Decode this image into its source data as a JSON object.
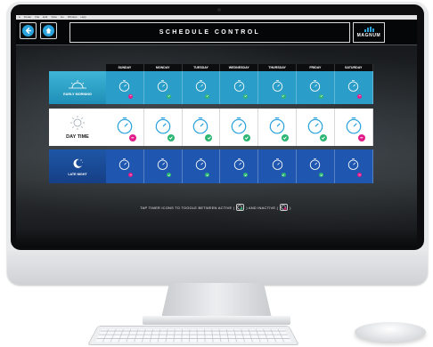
{
  "menubar": {
    "items": [
      "",
      "Finder",
      "File",
      "Edit",
      "View",
      "Go",
      "Window",
      "Help"
    ]
  },
  "header": {
    "title": "SCHEDULE CONTROL",
    "logo_text": "MAGNUM",
    "back_icon": "arrow-left-icon",
    "home_icon": "home-icon"
  },
  "days": [
    "SUNDAY",
    "MONDAY",
    "TUESDAY",
    "WEDNESDAY",
    "THURSDAY",
    "FRIDAY",
    "SATURDAY"
  ],
  "rows": [
    {
      "label": "EARLY MORNING",
      "icon": "sunrise-icon",
      "cells": [
        "inactive",
        "active",
        "active",
        "active",
        "active",
        "active",
        "inactive"
      ]
    },
    {
      "label": "DAY TIME",
      "icon": "sun-icon",
      "cells": [
        "inactive",
        "active",
        "active",
        "active",
        "active",
        "active",
        "inactive"
      ]
    },
    {
      "label": "LATE NIGHT",
      "icon": "moon-icon",
      "cells": [
        "inactive",
        "active",
        "active",
        "active",
        "active",
        "active",
        "inactive"
      ]
    }
  ],
  "hint": {
    "part1": "TAP TIMER ICONS TO TOGGLE BETWEEN ACTIVE (",
    "part2": ") AND INACTIVE (",
    "part3": ")"
  },
  "colors": {
    "accent": "#2aa3dd",
    "active_badge": "#2bb673",
    "inactive_badge": "#e21c8a",
    "morning": "#2a9ec8",
    "night": "#1f57b0"
  }
}
